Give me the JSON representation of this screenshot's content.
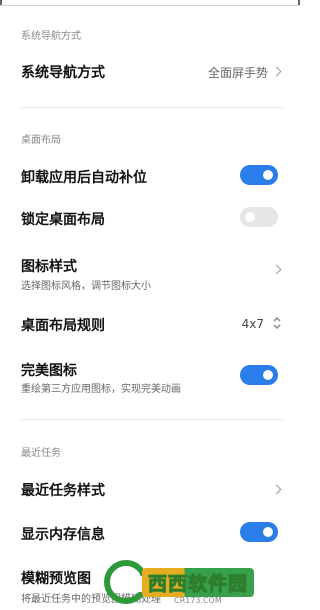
{
  "sections": {
    "nav": {
      "title": "系统导航方式"
    },
    "desktop": {
      "title": "桌面布局"
    },
    "recent": {
      "title": "最近任务"
    }
  },
  "rows": {
    "nav_mode": {
      "label": "系统导航方式",
      "value": "全面屏手势"
    },
    "auto_fill": {
      "label": "卸载应用后自动补位",
      "toggle": "on"
    },
    "lock_layout": {
      "label": "锁定桌面布局",
      "toggle": "off"
    },
    "icon_style": {
      "label": "图标样式",
      "sub": "选择图标风格，调节图标大小"
    },
    "layout_rule": {
      "label": "桌面布局规则",
      "value": "4x7"
    },
    "perfect_icon": {
      "label": "完美图标",
      "sub": "重绘第三方应用图标，实现完美动画",
      "toggle": "on"
    },
    "recent_style": {
      "label": "最近任务样式"
    },
    "memory_info": {
      "label": "显示内存信息",
      "toggle": "on"
    },
    "blur_preview": {
      "label": "模糊预览图",
      "sub": "将最近任务中的预览图模糊处理"
    }
  },
  "watermark": {
    "brand": "西西软件园",
    "url": "CR173.COM"
  },
  "colors": {
    "accent": "#2b7de9",
    "toggle_off": "#e6e6e6"
  }
}
